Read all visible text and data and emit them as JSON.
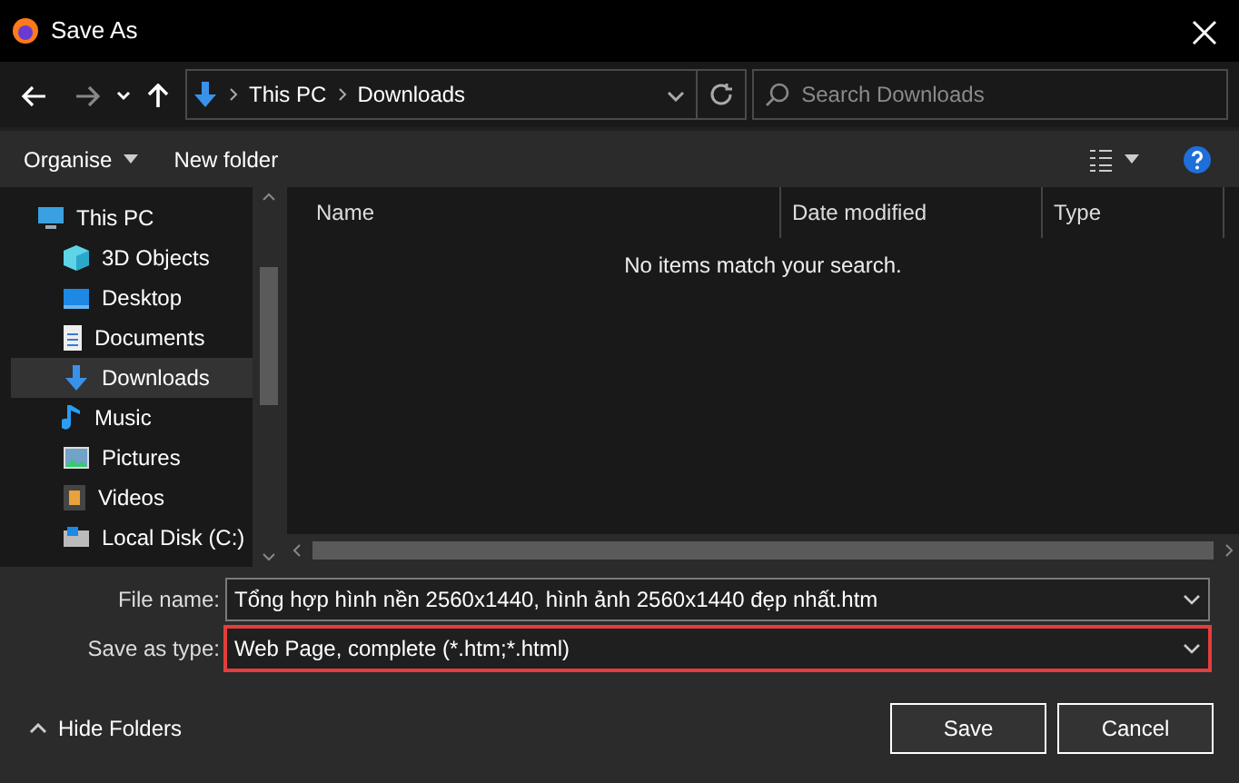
{
  "window": {
    "title": "Save As"
  },
  "address": {
    "crumbs": [
      "This PC",
      "Downloads"
    ]
  },
  "search": {
    "placeholder": "Search Downloads"
  },
  "toolbar": {
    "buttons": [
      {
        "label": "Organise",
        "dropdown": true
      },
      {
        "label": "New folder",
        "dropdown": false
      }
    ]
  },
  "sidebar": {
    "items": [
      {
        "label": "This PC",
        "kind": "pc",
        "selected": false,
        "children": [
          {
            "label": "3D Objects",
            "kind": "cube",
            "selected": false
          },
          {
            "label": "Desktop",
            "kind": "desktop",
            "selected": false
          },
          {
            "label": "Documents",
            "kind": "document",
            "selected": false
          },
          {
            "label": "Downloads",
            "kind": "download",
            "selected": true
          },
          {
            "label": "Music",
            "kind": "music",
            "selected": false
          },
          {
            "label": "Pictures",
            "kind": "picture",
            "selected": false
          },
          {
            "label": "Videos",
            "kind": "video",
            "selected": false
          },
          {
            "label": "Local Disk (C:)",
            "kind": "disk",
            "selected": false
          }
        ]
      }
    ]
  },
  "table": {
    "columns": [
      "Name",
      "Date modified",
      "Type"
    ],
    "empty_message": "No items match your search."
  },
  "form": {
    "fields": [
      {
        "label": "File name:",
        "value": "Tổng hợp hình nền 2560x1440, hình ảnh 2560x1440 đẹp nhất.htm",
        "highlighted": false
      },
      {
        "label": "Save as type:",
        "value": "Web Page, complete (*.htm;*.html)",
        "highlighted": true
      }
    ]
  },
  "footer": {
    "hide_folders": "Hide Folders",
    "buttons": [
      "Save",
      "Cancel"
    ]
  }
}
